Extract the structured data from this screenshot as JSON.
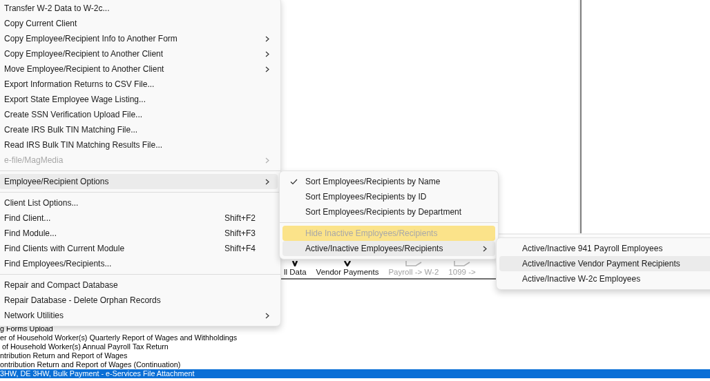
{
  "main_menu": {
    "items": [
      {
        "kind": "item",
        "label": "Transfer W-2 Data to W-2c...",
        "submenu": false,
        "disabled": false,
        "selected": false
      },
      {
        "kind": "item",
        "label": "Copy Current Client",
        "submenu": false,
        "disabled": false,
        "selected": false
      },
      {
        "kind": "item",
        "label": "Copy Employee/Recipient Info to Another Form",
        "submenu": true,
        "disabled": false,
        "selected": false
      },
      {
        "kind": "item",
        "label": "Copy Employee/Recipient to Another Client",
        "submenu": true,
        "disabled": false,
        "selected": false
      },
      {
        "kind": "item",
        "label": "Move Employee/Recipient to Another Client",
        "submenu": true,
        "disabled": false,
        "selected": false
      },
      {
        "kind": "item",
        "label": "Export Information Returns to CSV File...",
        "submenu": false,
        "disabled": false,
        "selected": false
      },
      {
        "kind": "item",
        "label": "Export State Employee Wage Listing...",
        "submenu": false,
        "disabled": false,
        "selected": false
      },
      {
        "kind": "item",
        "label": "Create SSN Verification Upload File...",
        "submenu": false,
        "disabled": false,
        "selected": false
      },
      {
        "kind": "item",
        "label": "Create IRS Bulk TIN Matching File...",
        "submenu": false,
        "disabled": false,
        "selected": false
      },
      {
        "kind": "item",
        "label": "Read IRS Bulk TIN Matching Results File...",
        "submenu": false,
        "disabled": false,
        "selected": false
      },
      {
        "kind": "item",
        "label": "e-file/MagMedia",
        "submenu": true,
        "disabled": true,
        "selected": false
      },
      {
        "kind": "separator"
      },
      {
        "kind": "item",
        "label": "Employee/Recipient Options",
        "submenu": true,
        "disabled": false,
        "selected": true
      },
      {
        "kind": "separator"
      },
      {
        "kind": "item",
        "label": "Client List Options...",
        "submenu": false,
        "disabled": false,
        "selected": false
      },
      {
        "kind": "item",
        "label": "Find Client...",
        "shortcut": "Shift+F2",
        "submenu": false,
        "disabled": false,
        "selected": false
      },
      {
        "kind": "item",
        "label": "Find Module...",
        "shortcut": "Shift+F3",
        "submenu": false,
        "disabled": false,
        "selected": false
      },
      {
        "kind": "item",
        "label": "Find Clients with Current Module",
        "shortcut": "Shift+F4",
        "submenu": false,
        "disabled": false,
        "selected": false
      },
      {
        "kind": "item",
        "label": "Find Employees/Recipients...",
        "submenu": false,
        "disabled": false,
        "selected": false
      },
      {
        "kind": "separator"
      },
      {
        "kind": "item",
        "label": "Repair and Compact Database",
        "submenu": false,
        "disabled": false,
        "selected": false
      },
      {
        "kind": "item",
        "label": "Repair Database - Delete Orphan Records",
        "submenu": false,
        "disabled": false,
        "selected": false
      },
      {
        "kind": "item",
        "label": "Network Utilities",
        "submenu": true,
        "disabled": false,
        "selected": false
      }
    ]
  },
  "options_submenu": {
    "items": [
      {
        "kind": "item",
        "label": "Sort Employees/Recipients by Name",
        "checked": true,
        "submenu": false,
        "disabled": false,
        "selected": false,
        "highlighted": false
      },
      {
        "kind": "item",
        "label": "Sort Employees/Recipients by ID",
        "checked": false,
        "submenu": false,
        "disabled": false,
        "selected": false,
        "highlighted": false
      },
      {
        "kind": "item",
        "label": "Sort Employees/Recipients by Department",
        "checked": false,
        "submenu": false,
        "disabled": false,
        "selected": false,
        "highlighted": false
      },
      {
        "kind": "separator"
      },
      {
        "kind": "item",
        "label": "Hide Inactive Employees/Recipients",
        "checked": false,
        "submenu": false,
        "disabled": true,
        "selected": false,
        "highlighted": true
      },
      {
        "kind": "item",
        "label": "Active/Inactive Employees/Recipients",
        "checked": false,
        "submenu": true,
        "disabled": false,
        "selected": true,
        "highlighted": false
      }
    ]
  },
  "active_inactive_submenu": {
    "items": [
      {
        "kind": "item",
        "label": "Active/Inactive 941 Payroll Employees",
        "selected": false
      },
      {
        "kind": "item",
        "label": "Active/Inactive Vendor Payment Recipients",
        "selected": true
      },
      {
        "kind": "item",
        "label": "Active/Inactive W-2c Employees",
        "selected": false
      }
    ]
  },
  "toolbar": {
    "items": [
      {
        "label": "ll Data",
        "disabled": false
      },
      {
        "label": "Vendor Payments",
        "disabled": false
      },
      {
        "label": "Payroll -> W-2",
        "disabled": true
      },
      {
        "label": "1099 ->",
        "disabled": true
      }
    ]
  },
  "form_list": {
    "rows": [
      {
        "text": "g Forms Upload",
        "selected": false
      },
      {
        "text": "er of Household Worker(s) Quarterly Report of Wages and Withholdings",
        "selected": false
      },
      {
        "text": " of Household Worker(s) Annual Payroll Tax Return",
        "selected": false
      },
      {
        "text": "ntribution Return and Report of Wages",
        "selected": false
      },
      {
        "text": "ontribution Return and Report of Wages (Continuation)",
        "selected": false
      },
      {
        "text": "3HW, DE 3HW, Bulk Payment - e-Services File Attachment",
        "selected": true
      }
    ]
  }
}
